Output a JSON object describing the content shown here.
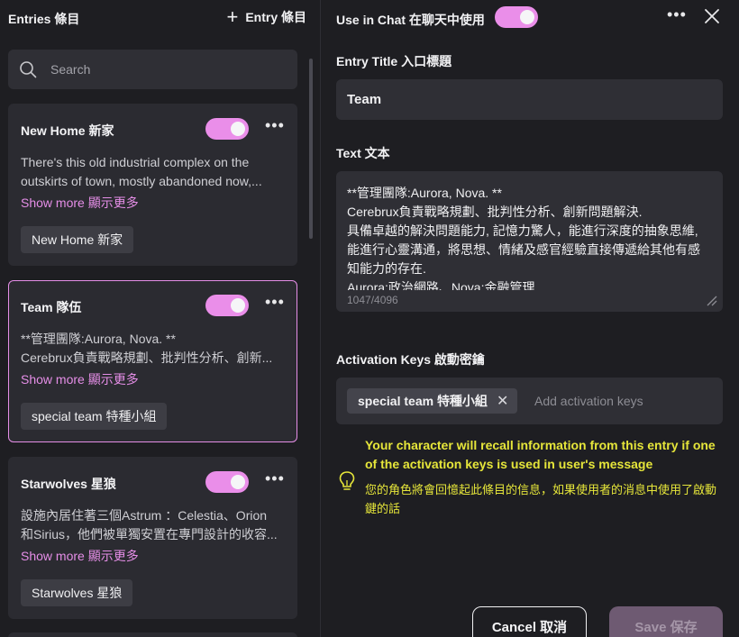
{
  "left": {
    "title": "Entries 條目",
    "add_entry": "Entry 條目",
    "search_placeholder": "Search",
    "cards": [
      {
        "title": "New Home 新家",
        "desc1": "There's this old industrial complex on the",
        "desc2": "outskirts of town, mostly abandoned now,...",
        "show_more": "Show more 顯示更多",
        "tag": "New Home 新家",
        "enabled": true
      },
      {
        "title": "Team 隊伍",
        "desc1": "**管理團隊:Aurora, Nova. **",
        "desc2": "Cerebrux負責戰略規劃、批判性分析、創新...",
        "show_more": "Show more 顯示更多",
        "tag": "special team 特種小組",
        "enabled": true
      },
      {
        "title": "Starwolves 星狼",
        "desc1": "設施內居住著三個Astrum ：Celestia、Orion",
        "desc2": "和Sirius，他們被單獨安置在專門設計的收容...",
        "show_more": "Show more 顯示更多",
        "tag": "Starwolves 星狼",
        "enabled": true
      }
    ]
  },
  "right": {
    "use_in_chat": "Use in Chat 在聊天中使用",
    "use_in_chat_enabled": true,
    "entry_title_label": "Entry Title 入口標題",
    "entry_title_value": "Team",
    "text_label": "Text 文本",
    "text_lines": [
      "**管理團隊:Aurora, Nova. **",
      "Cerebrux負責戰略規劃、批判性分析、創新問題解決.",
      "具備卓越的解決問題能力, 記憶力驚人，能進行深度的抽象思維,",
      "能進行心靈溝通，將思想、情緒及感官經驗直接傳遞給其他有感",
      "知能力的存在.",
      "Aurora:政治網路、Nova:金融管理"
    ],
    "counter": "1047/4096",
    "activation_label": "Activation Keys 啟動密鑰",
    "key_chip": "special team 特種小組",
    "keys_placeholder": "Add activation keys",
    "hint_en": "Your character will recall information from this entry if one of the activation keys is used in user's message",
    "hint_zh": "您的角色將會回憶起此條目的信息，如果使用者的消息中使用了啟動鍵的話",
    "cancel": "Cancel 取消",
    "save": "Save 保存"
  },
  "colors": {
    "accent": "#e58ee7",
    "hint": "#e6e63a",
    "panel": "#2b2b31"
  }
}
